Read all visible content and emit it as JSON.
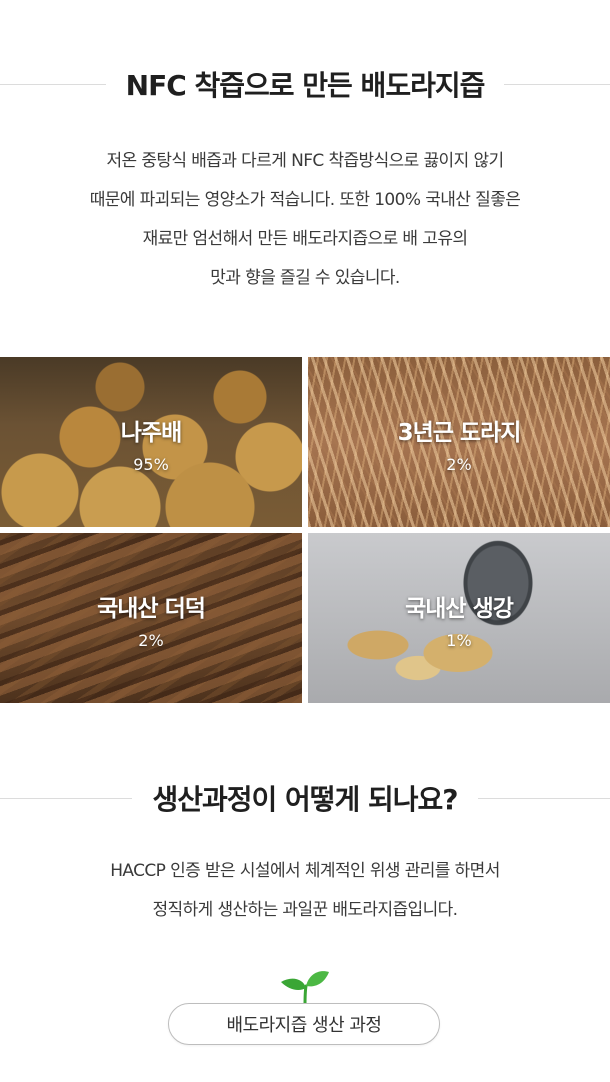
{
  "section1": {
    "title": "NFC 착즙으로 만든 배도라지즙",
    "description": [
      "저온 중탕식 배즙과 다르게 NFC 착즙방식으로 끓이지 않기",
      "때문에 파괴되는 영양소가 적습니다. 또한 100% 국내산 질좋은",
      "재료만 엄선해서 만든 배도라지즙으로 배 고유의",
      "맛과 향을 즐길 수 있습니다."
    ]
  },
  "ingredients": [
    {
      "name": "나주배",
      "percent": "95%"
    },
    {
      "name": "3년근 도라지",
      "percent": "2%"
    },
    {
      "name": "국내산 더덕",
      "percent": "2%"
    },
    {
      "name": "국내산 생강",
      "percent": "1%"
    }
  ],
  "section2": {
    "title": "생산과정이 어떻게 되나요?",
    "description": [
      "HACCP 인증 받은 시설에서 체계적인 위생 관리를 하면서",
      "정직하게 생산하는 과일꾼 배도라지즙입니다."
    ]
  },
  "process_button": {
    "label": "배도라지즙 생산 과정",
    "icon": "sprout-icon"
  },
  "colors": {
    "accent_green": "#3aa635",
    "text": "#333333"
  }
}
